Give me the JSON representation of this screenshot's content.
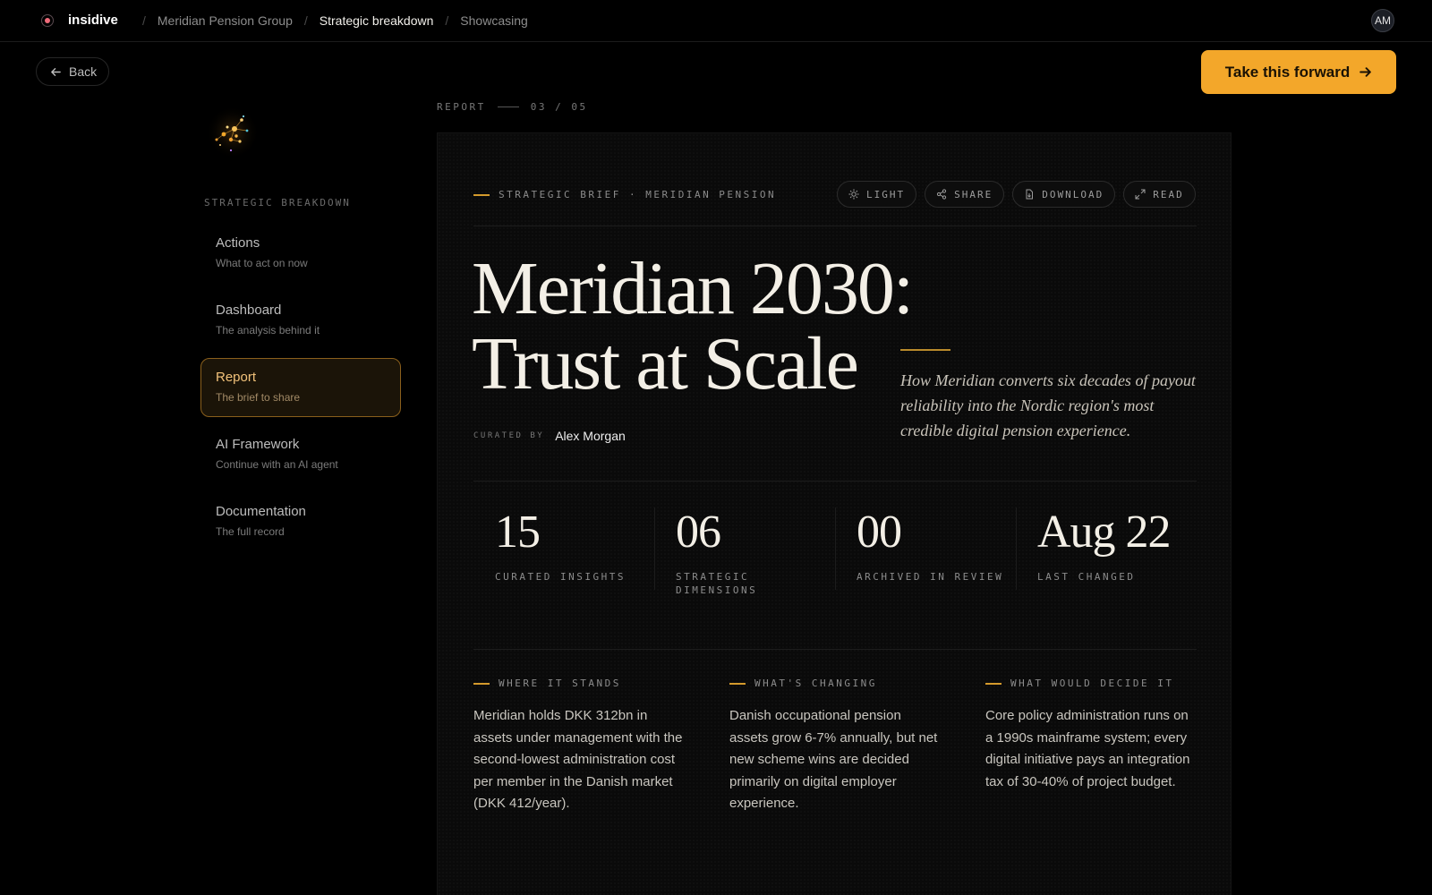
{
  "app": {
    "brand": "insidive",
    "avatar_initials": "AM"
  },
  "breadcrumb": [
    "Meridian Pension Group",
    "Strategic breakdown",
    "Showcasing"
  ],
  "toolbar": {
    "back_label": "Back",
    "cta_label": "Take this forward"
  },
  "sidebar": {
    "section_label": "STRATEGIC BREAKDOWN",
    "items": [
      {
        "title": "Actions",
        "subtitle": "What to act on now",
        "active": false
      },
      {
        "title": "Dashboard",
        "subtitle": "The analysis behind it",
        "active": false
      },
      {
        "title": "Report",
        "subtitle": "The brief to share",
        "active": true
      },
      {
        "title": "AI Framework",
        "subtitle": "Continue with an AI agent",
        "active": false
      },
      {
        "title": "Documentation",
        "subtitle": "The full record",
        "active": false
      }
    ]
  },
  "report": {
    "meta_label": "REPORT",
    "page_indicator": "03 / 05",
    "kicker": "STRATEGIC BRIEF · MERIDIAN PENSION",
    "actions": [
      "LIGHT",
      "SHARE",
      "DOWNLOAD",
      "READ"
    ],
    "title_line1": "Meridian 2030:",
    "title_line2": "Trust at Scale",
    "curated_label": "CURATED BY",
    "curator": "Alex Morgan",
    "tagline": "How Meridian converts six decades of payout reliability into the Nordic region's most credible digital pension experience.",
    "stats": [
      {
        "value": "15",
        "label": "CURATED INSIGHTS"
      },
      {
        "value": "06",
        "label": "STRATEGIC DIMENSIONS"
      },
      {
        "value": "00",
        "label": "ARCHIVED IN REVIEW"
      },
      {
        "value": "Aug 22",
        "label": "LAST CHANGED"
      }
    ],
    "columns": [
      {
        "heading": "WHERE IT STANDS",
        "body": "Meridian holds DKK 312bn in assets under management with the second-lowest administration cost per member in the Danish market (DKK 412/year)."
      },
      {
        "heading": "WHAT'S CHANGING",
        "body": "Danish occupational pension assets grow 6-7% annually, but net new scheme wins are decided primarily on digital employer experience."
      },
      {
        "heading": "WHAT WOULD DECIDE IT",
        "body": "Core policy administration runs on a 1990s mainframe system; every digital initiative pays an integration tax of 30-40% of project budget."
      }
    ]
  },
  "colors": {
    "accent": "#f3a72a",
    "active_border": "#8a5f1c",
    "background": "#000000"
  }
}
